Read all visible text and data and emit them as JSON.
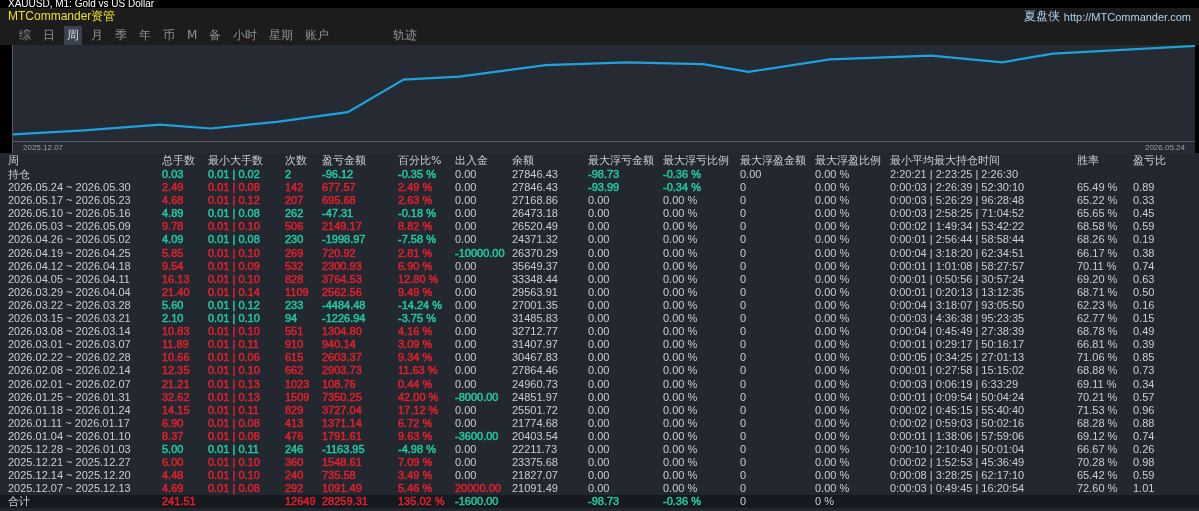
{
  "window": {
    "title": "XAUUSD, M1: Gold vs US Dollar"
  },
  "header": {
    "app_name": "MTCommander资管",
    "brand": "夏盘侠",
    "link": "http://MTCommander.com"
  },
  "tabs": [
    {
      "label": "综",
      "kind": "view",
      "selected": false
    },
    {
      "label": "日",
      "kind": "view",
      "selected": false
    },
    {
      "label": "周",
      "kind": "view",
      "selected": true
    },
    {
      "label": "月",
      "kind": "view",
      "selected": false
    },
    {
      "label": "季",
      "kind": "view",
      "selected": false
    },
    {
      "label": "年",
      "kind": "view",
      "selected": false
    },
    {
      "label": "币",
      "kind": "view",
      "selected": false
    },
    {
      "label": "M",
      "kind": "view",
      "selected": false
    },
    {
      "label": "备",
      "kind": "view",
      "selected": false
    },
    {
      "label": "小时",
      "kind": "view",
      "selected": false
    },
    {
      "label": "星期",
      "kind": "view",
      "selected": false
    },
    {
      "label": "账户",
      "kind": "panel",
      "selected": false
    },
    {
      "label": "轨迹",
      "kind": "panel",
      "selected": false
    }
  ],
  "chart": {
    "start_label": "2025.12.07",
    "end_label": "2026.05.24"
  },
  "table": {
    "columns": [
      "周",
      "总手数",
      "最小大手数",
      "次数",
      "盈亏金额",
      "百分比%",
      "出入金",
      "余额",
      "最大浮亏金额",
      "最大浮亏比例",
      "最大浮盈金额",
      "最大浮盈比例",
      "最小平均最大持仓时间",
      "胜率",
      "盈亏比"
    ],
    "rows": [
      {
        "period": "持仓",
        "lots": {
          "text": "0.03",
          "color": "#22c7a0"
        },
        "lot_range": {
          "text": "0.01 | 0.02",
          "color": "#22c7a0"
        },
        "trades": {
          "text": "2",
          "color": "#22c7a0"
        },
        "profit": {
          "text": "-96.12",
          "color": "#22c7a0"
        },
        "percent": {
          "text": "-0.35 %",
          "color": "#22c7a0"
        },
        "flow": "0.00",
        "balance": "27846.43",
        "max_float_loss": {
          "text": "-98.73",
          "color": "#22c7a0"
        },
        "max_float_loss_pct": {
          "text": "-0.36 %",
          "color": "#22c7a0"
        },
        "max_float_profit": "0.00",
        "max_float_profit_pct": "0.00 %",
        "hold_times": "2:20:21 | 2:23:25 | 2:26:30"
      },
      {
        "period": "2026.05.24 ~ 2026.05.30",
        "lots": {
          "text": "2.49",
          "color": "#e0202c"
        },
        "lot_range": {
          "text": "0.01 | 0.08",
          "color": "#e0202c"
        },
        "trades": {
          "text": "142",
          "color": "#e0202c"
        },
        "profit": {
          "text": "677.57",
          "color": "#e0202c"
        },
        "percent": {
          "text": "2.49 %",
          "color": "#e0202c"
        },
        "flow": "0.00",
        "balance": "27846.43",
        "max_float_loss": {
          "text": "-93.99",
          "color": "#22c7a0"
        },
        "max_float_loss_pct": {
          "text": "-0.34 %",
          "color": "#22c7a0"
        },
        "max_float_profit": "0",
        "max_float_profit_pct": "0.00 %",
        "hold_times": "0:00:03 | 2:26:39 | 52:30:10",
        "win_rate": "65.49 %",
        "pl_ratio": "0.89"
      },
      {
        "period": "2026.05.17 ~ 2026.05.23",
        "lots": {
          "text": "4.68",
          "color": "#e0202c"
        },
        "lot_range": {
          "text": "0.01 | 0.12",
          "color": "#e0202c"
        },
        "trades": {
          "text": "207",
          "color": "#e0202c"
        },
        "profit": {
          "text": "695.68",
          "color": "#e0202c"
        },
        "percent": {
          "text": "2.63 %",
          "color": "#e0202c"
        },
        "flow": "0.00",
        "balance": "27168.86",
        "max_float_loss": "0.00",
        "max_float_loss_pct": "0.00 %",
        "max_float_profit": "0",
        "max_float_profit_pct": "0.00 %",
        "hold_times": "0:00:03 | 5:26:29 | 96:28:48",
        "win_rate": "65.22 %",
        "pl_ratio": "0.33"
      },
      {
        "period": "2026.05.10 ~ 2026.05.16",
        "lots": {
          "text": "4.89",
          "color": "#22c7a0"
        },
        "lot_range": {
          "text": "0.01 | 0.08",
          "color": "#22c7a0"
        },
        "trades": {
          "text": "262",
          "color": "#22c7a0"
        },
        "profit": {
          "text": "-47.31",
          "color": "#22c7a0"
        },
        "percent": {
          "text": "-0.18 %",
          "color": "#22c7a0"
        },
        "flow": "0.00",
        "balance": "26473.18",
        "max_float_loss": "0.00",
        "max_float_loss_pct": "0.00 %",
        "max_float_profit": "0",
        "max_float_profit_pct": "0.00 %",
        "hold_times": "0:00:03 | 2:58:25 | 71:04:52",
        "win_rate": "65.65 %",
        "pl_ratio": "0.45"
      },
      {
        "period": "2026.05.03 ~ 2026.05.09",
        "lots": {
          "text": "9.78",
          "color": "#e0202c"
        },
        "lot_range": {
          "text": "0.01 | 0.10",
          "color": "#e0202c"
        },
        "trades": {
          "text": "506",
          "color": "#e0202c"
        },
        "profit": {
          "text": "2149.17",
          "color": "#e0202c"
        },
        "percent": {
          "text": "8.82 %",
          "color": "#e0202c"
        },
        "flow": "0.00",
        "balance": "26520.49",
        "max_float_loss": "0.00",
        "max_float_loss_pct": "0.00 %",
        "max_float_profit": "0",
        "max_float_profit_pct": "0.00 %",
        "hold_times": "0:00:02 | 1:49:34 | 53:42:22",
        "win_rate": "68.58 %",
        "pl_ratio": "0.59"
      },
      {
        "period": "2026.04.26 ~ 2026.05.02",
        "lots": {
          "text": "4.09",
          "color": "#22c7a0"
        },
        "lot_range": {
          "text": "0.01 | 0.08",
          "color": "#22c7a0"
        },
        "trades": {
          "text": "230",
          "color": "#22c7a0"
        },
        "profit": {
          "text": "-1998.97",
          "color": "#22c7a0"
        },
        "percent": {
          "text": "-7.58 %",
          "color": "#22c7a0"
        },
        "flow": "0.00",
        "balance": "24371.32",
        "max_float_loss": "0.00",
        "max_float_loss_pct": "0.00 %",
        "max_float_profit": "0",
        "max_float_profit_pct": "0.00 %",
        "hold_times": "0:00:01 | 2:56:44 | 58:58:44",
        "win_rate": "68.26 %",
        "pl_ratio": "0.19"
      },
      {
        "period": "2026.04.19 ~ 2026.04.25",
        "lots": {
          "text": "5.85",
          "color": "#e0202c"
        },
        "lot_range": {
          "text": "0.01 | 0.10",
          "color": "#e0202c"
        },
        "trades": {
          "text": "269",
          "color": "#e0202c"
        },
        "profit": {
          "text": "720.92",
          "color": "#e0202c"
        },
        "percent": {
          "text": "2.81 %",
          "color": "#e0202c"
        },
        "flow": {
          "text": "-10000.00",
          "color": "#22c7a0"
        },
        "balance": "26370.29",
        "max_float_loss": "0.00",
        "max_float_loss_pct": "0.00 %",
        "max_float_profit": "0",
        "max_float_profit_pct": "0.00 %",
        "hold_times": "0:00:04 | 3:18:20 | 62:34:51",
        "win_rate": "66.17 %",
        "pl_ratio": "0.38"
      },
      {
        "period": "2026.04.12 ~ 2026.04.18",
        "lots": {
          "text": "9.54",
          "color": "#e0202c"
        },
        "lot_range": {
          "text": "0.01 | 0.09",
          "color": "#e0202c"
        },
        "trades": {
          "text": "532",
          "color": "#e0202c"
        },
        "profit": {
          "text": "2300.93",
          "color": "#e0202c"
        },
        "percent": {
          "text": "6.90 %",
          "color": "#e0202c"
        },
        "flow": "0.00",
        "balance": "35649.37",
        "max_float_loss": "0.00",
        "max_float_loss_pct": "0.00 %",
        "max_float_profit": "0",
        "max_float_profit_pct": "0.00 %",
        "hold_times": "0:00:01 | 1:01:08 | 58:27:57",
        "win_rate": "70.11 %",
        "pl_ratio": "0.74"
      },
      {
        "period": "2026.04.05 ~ 2026.04.11",
        "lots": {
          "text": "16.13",
          "color": "#e0202c"
        },
        "lot_range": {
          "text": "0.01 | 0.10",
          "color": "#e0202c"
        },
        "trades": {
          "text": "828",
          "color": "#e0202c"
        },
        "profit": {
          "text": "3764.53",
          "color": "#e0202c"
        },
        "percent": {
          "text": "12.80 %",
          "color": "#e0202c"
        },
        "flow": "0.00",
        "balance": "33348.44",
        "max_float_loss": "0.00",
        "max_float_loss_pct": "0.00 %",
        "max_float_profit": "0",
        "max_float_profit_pct": "0.00 %",
        "hold_times": "0:00:01 | 0:50:56 | 30:57:24",
        "win_rate": "69.20 %",
        "pl_ratio": "0.63"
      },
      {
        "period": "2026.03.29 ~ 2026.04.04",
        "lots": {
          "text": "21.40",
          "color": "#e0202c"
        },
        "lot_range": {
          "text": "0.01 | 0.14",
          "color": "#e0202c"
        },
        "trades": {
          "text": "1109",
          "color": "#e0202c"
        },
        "profit": {
          "text": "2562.56",
          "color": "#e0202c"
        },
        "percent": {
          "text": "9.49 %",
          "color": "#e0202c"
        },
        "flow": "0.00",
        "balance": "29563.91",
        "max_float_loss": "0.00",
        "max_float_loss_pct": "0.00 %",
        "max_float_profit": "0",
        "max_float_profit_pct": "0.00 %",
        "hold_times": "0:00:01 | 0:20:13 | 13:12:35",
        "win_rate": "68.71 %",
        "pl_ratio": "0.50"
      },
      {
        "period": "2026.03.22 ~ 2026.03.28",
        "lots": {
          "text": "5.60",
          "color": "#22c7a0"
        },
        "lot_range": {
          "text": "0.01 | 0.12",
          "color": "#22c7a0"
        },
        "trades": {
          "text": "233",
          "color": "#22c7a0"
        },
        "profit": {
          "text": "-4484.48",
          "color": "#22c7a0"
        },
        "percent": {
          "text": "-14.24 %",
          "color": "#22c7a0"
        },
        "flow": "0.00",
        "balance": "27001.35",
        "max_float_loss": "0.00",
        "max_float_loss_pct": "0.00 %",
        "max_float_profit": "0",
        "max_float_profit_pct": "0.00 %",
        "hold_times": "0:00:04 | 3:18:07 | 93:05:50",
        "win_rate": "62.23 %",
        "pl_ratio": "0.16"
      },
      {
        "period": "2026.03.15 ~ 2026.03.21",
        "lots": {
          "text": "2.10",
          "color": "#22c7a0"
        },
        "lot_range": {
          "text": "0.01 | 0.10",
          "color": "#22c7a0"
        },
        "trades": {
          "text": "94",
          "color": "#22c7a0"
        },
        "profit": {
          "text": "-1226.94",
          "color": "#22c7a0"
        },
        "percent": {
          "text": "-3.75 %",
          "color": "#22c7a0"
        },
        "flow": "0.00",
        "balance": "31485.83",
        "max_float_loss": "0.00",
        "max_float_loss_pct": "0.00 %",
        "max_float_profit": "0",
        "max_float_profit_pct": "0.00 %",
        "hold_times": "0:00:03 | 4:36:38 | 95:23:35",
        "win_rate": "62.77 %",
        "pl_ratio": "0.15"
      },
      {
        "period": "2026.03.08 ~ 2026.03.14",
        "lots": {
          "text": "10.83",
          "color": "#e0202c"
        },
        "lot_range": {
          "text": "0.01 | 0.10",
          "color": "#e0202c"
        },
        "trades": {
          "text": "551",
          "color": "#e0202c"
        },
        "profit": {
          "text": "1304.80",
          "color": "#e0202c"
        },
        "percent": {
          "text": "4.16 %",
          "color": "#e0202c"
        },
        "flow": "0.00",
        "balance": "32712.77",
        "max_float_loss": "0.00",
        "max_float_loss_pct": "0.00 %",
        "max_float_profit": "0",
        "max_float_profit_pct": "0.00 %",
        "hold_times": "0:00:04 | 0:45:49 | 27:38:39",
        "win_rate": "68.78 %",
        "pl_ratio": "0.49"
      },
      {
        "period": "2026.03.01 ~ 2026.03.07",
        "lots": {
          "text": "11.89",
          "color": "#e0202c"
        },
        "lot_range": {
          "text": "0.01 | 0.11",
          "color": "#e0202c"
        },
        "trades": {
          "text": "910",
          "color": "#e0202c"
        },
        "profit": {
          "text": "940.14",
          "color": "#e0202c"
        },
        "percent": {
          "text": "3.09 %",
          "color": "#e0202c"
        },
        "flow": "0.00",
        "balance": "31407.97",
        "max_float_loss": "0.00",
        "max_float_loss_pct": "0.00 %",
        "max_float_profit": "0",
        "max_float_profit_pct": "0.00 %",
        "hold_times": "0:00:01 | 0:29:17 | 50:16:17",
        "win_rate": "66.81 %",
        "pl_ratio": "0.39"
      },
      {
        "period": "2026.02.22 ~ 2026.02.28",
        "lots": {
          "text": "10.66",
          "color": "#e0202c"
        },
        "lot_range": {
          "text": "0.01 | 0.06",
          "color": "#e0202c"
        },
        "trades": {
          "text": "615",
          "color": "#e0202c"
        },
        "profit": {
          "text": "2603.37",
          "color": "#e0202c"
        },
        "percent": {
          "text": "9.34 %",
          "color": "#e0202c"
        },
        "flow": "0.00",
        "balance": "30467.83",
        "max_float_loss": "0.00",
        "max_float_loss_pct": "0.00 %",
        "max_float_profit": "0",
        "max_float_profit_pct": "0.00 %",
        "hold_times": "0:00:05 | 0:34:25 | 27:01:13",
        "win_rate": "71.06 %",
        "pl_ratio": "0.85"
      },
      {
        "period": "2026.02.08 ~ 2026.02.14",
        "lots": {
          "text": "12.35",
          "color": "#e0202c"
        },
        "lot_range": {
          "text": "0.01 | 0.10",
          "color": "#e0202c"
        },
        "trades": {
          "text": "662",
          "color": "#e0202c"
        },
        "profit": {
          "text": "2903.73",
          "color": "#e0202c"
        },
        "percent": {
          "text": "11.63 %",
          "color": "#e0202c"
        },
        "flow": "0.00",
        "balance": "27864.46",
        "max_float_loss": "0.00",
        "max_float_loss_pct": "0.00 %",
        "max_float_profit": "0",
        "max_float_profit_pct": "0.00 %",
        "hold_times": "0:00:01 | 0:27:58 | 15:15:02",
        "win_rate": "68.88 %",
        "pl_ratio": "0.73"
      },
      {
        "period": "2026.02.01 ~ 2026.02.07",
        "lots": {
          "text": "21.21",
          "color": "#e0202c"
        },
        "lot_range": {
          "text": "0.01 | 0.13",
          "color": "#e0202c"
        },
        "trades": {
          "text": "1023",
          "color": "#e0202c"
        },
        "profit": {
          "text": "108.76",
          "color": "#e0202c"
        },
        "percent": {
          "text": "0.44 %",
          "color": "#e0202c"
        },
        "flow": "0.00",
        "balance": "24960.73",
        "max_float_loss": "0.00",
        "max_float_loss_pct": "0.00 %",
        "max_float_profit": "0",
        "max_float_profit_pct": "0.00 %",
        "hold_times": "0:00:03 | 0:06:19 | 6:33:29",
        "win_rate": "69.11 %",
        "pl_ratio": "0.34"
      },
      {
        "period": "2026.01.25 ~ 2026.01.31",
        "lots": {
          "text": "32.62",
          "color": "#e0202c"
        },
        "lot_range": {
          "text": "0.01 | 0.13",
          "color": "#e0202c"
        },
        "trades": {
          "text": "1509",
          "color": "#e0202c"
        },
        "profit": {
          "text": "7350.25",
          "color": "#e0202c"
        },
        "percent": {
          "text": "42.00 %",
          "color": "#e0202c"
        },
        "flow": {
          "text": "-8000.00",
          "color": "#22c7a0"
        },
        "balance": "24851.97",
        "max_float_loss": "0.00",
        "max_float_loss_pct": "0.00 %",
        "max_float_profit": "0",
        "max_float_profit_pct": "0.00 %",
        "hold_times": "0:00:01 | 0:09:54 | 50:04:24",
        "win_rate": "70.21 %",
        "pl_ratio": "0.57"
      },
      {
        "period": "2026.01.18 ~ 2026.01.24",
        "lots": {
          "text": "14.15",
          "color": "#e0202c"
        },
        "lot_range": {
          "text": "0.01 | 0.11",
          "color": "#e0202c"
        },
        "trades": {
          "text": "829",
          "color": "#e0202c"
        },
        "profit": {
          "text": "3727.04",
          "color": "#e0202c"
        },
        "percent": {
          "text": "17.12 %",
          "color": "#e0202c"
        },
        "flow": "0.00",
        "balance": "25501.72",
        "max_float_loss": "0.00",
        "max_float_loss_pct": "0.00 %",
        "max_float_profit": "0",
        "max_float_profit_pct": "0.00 %",
        "hold_times": "0:00:02 | 0:45:15 | 55:40:40",
        "win_rate": "71.53 %",
        "pl_ratio": "0.96"
      },
      {
        "period": "2026.01.11 ~ 2026.01.17",
        "lots": {
          "text": "6.90",
          "color": "#e0202c"
        },
        "lot_range": {
          "text": "0.01 | 0.08",
          "color": "#e0202c"
        },
        "trades": {
          "text": "413",
          "color": "#e0202c"
        },
        "profit": {
          "text": "1371.14",
          "color": "#e0202c"
        },
        "percent": {
          "text": "6.72 %",
          "color": "#e0202c"
        },
        "flow": "0.00",
        "balance": "21774.68",
        "max_float_loss": "0.00",
        "max_float_loss_pct": "0.00 %",
        "max_float_profit": "0",
        "max_float_profit_pct": "0.00 %",
        "hold_times": "0:00:02 | 0:59:03 | 50:02:16",
        "win_rate": "68.28 %",
        "pl_ratio": "0.88"
      },
      {
        "period": "2026.01.04 ~ 2026.01.10",
        "lots": {
          "text": "8.37",
          "color": "#e0202c"
        },
        "lot_range": {
          "text": "0.01 | 0.08",
          "color": "#e0202c"
        },
        "trades": {
          "text": "476",
          "color": "#e0202c"
        },
        "profit": {
          "text": "1791.61",
          "color": "#e0202c"
        },
        "percent": {
          "text": "9.63 %",
          "color": "#e0202c"
        },
        "flow": {
          "text": "-3600.00",
          "color": "#22c7a0"
        },
        "balance": "20403.54",
        "max_float_loss": "0.00",
        "max_float_loss_pct": "0.00 %",
        "max_float_profit": "0",
        "max_float_profit_pct": "0.00 %",
        "hold_times": "0:00:01 | 1:38:06 | 57:59:06",
        "win_rate": "69.12 %",
        "pl_ratio": "0.74"
      },
      {
        "period": "2025.12.28 ~ 2026.01.03",
        "lots": {
          "text": "5.00",
          "color": "#22c7a0"
        },
        "lot_range": {
          "text": "0.01 | 0.11",
          "color": "#22c7a0"
        },
        "trades": {
          "text": "246",
          "color": "#22c7a0"
        },
        "profit": {
          "text": "-1163.95",
          "color": "#22c7a0"
        },
        "percent": {
          "text": "-4.98 %",
          "color": "#22c7a0"
        },
        "flow": "0.00",
        "balance": "22211.73",
        "max_float_loss": "0.00",
        "max_float_loss_pct": "0.00 %",
        "max_float_profit": "0",
        "max_float_profit_pct": "0.00 %",
        "hold_times": "0:00:10 | 2:10:40 | 50:01:04",
        "win_rate": "66.67 %",
        "pl_ratio": "0.26"
      },
      {
        "period": "2025.12.21 ~ 2025.12.27",
        "lots": {
          "text": "6.00",
          "color": "#e0202c"
        },
        "lot_range": {
          "text": "0.01 | 0.10",
          "color": "#e0202c"
        },
        "trades": {
          "text": "360",
          "color": "#e0202c"
        },
        "profit": {
          "text": "1548.61",
          "color": "#e0202c"
        },
        "percent": {
          "text": "7.09 %",
          "color": "#e0202c"
        },
        "flow": "0.00",
        "balance": "23375.68",
        "max_float_loss": "0.00",
        "max_float_loss_pct": "0.00 %",
        "max_float_profit": "0",
        "max_float_profit_pct": "0.00 %",
        "hold_times": "0:00:02 | 1:52:53 | 45:36:49",
        "win_rate": "70.28 %",
        "pl_ratio": "0.98"
      },
      {
        "period": "2025.12.14 ~ 2025.12.20",
        "lots": {
          "text": "4.48",
          "color": "#e0202c"
        },
        "lot_range": {
          "text": "0.01 | 0.10",
          "color": "#e0202c"
        },
        "trades": {
          "text": "240",
          "color": "#e0202c"
        },
        "profit": {
          "text": "735.58",
          "color": "#e0202c"
        },
        "percent": {
          "text": "3.49 %",
          "color": "#e0202c"
        },
        "flow": "0.00",
        "balance": "21827.07",
        "max_float_loss": "0.00",
        "max_float_loss_pct": "0.00 %",
        "max_float_profit": "0",
        "max_float_profit_pct": "0.00 %",
        "hold_times": "0:00:08 | 3:28:25 | 62:17:10",
        "win_rate": "65.42 %",
        "pl_ratio": "0.59"
      },
      {
        "period": "2025.12.07 ~ 2025.12.13",
        "lots": {
          "text": "4.69",
          "color": "#e0202c"
        },
        "lot_range": {
          "text": "0.01 | 0.08",
          "color": "#e0202c"
        },
        "trades": {
          "text": "292",
          "color": "#e0202c"
        },
        "profit": {
          "text": "1091.49",
          "color": "#e0202c"
        },
        "percent": {
          "text": "5.46 %",
          "color": "#e0202c"
        },
        "flow": {
          "text": "20000.00",
          "color": "#e0202c"
        },
        "balance": "21091.49",
        "max_float_loss": "0.00",
        "max_float_loss_pct": "0.00 %",
        "max_float_profit": "0",
        "max_float_profit_pct": "0.00 %",
        "hold_times": "0:00:03 | 0:49:45 | 16:20:54",
        "win_rate": "72.60 %",
        "pl_ratio": "1.01"
      }
    ],
    "total": {
      "period": "合计",
      "lots": {
        "text": "241.51",
        "color": "#e0202c"
      },
      "trades": {
        "text": "12649",
        "color": "#e0202c"
      },
      "profit": {
        "text": "28259.31",
        "color": "#e0202c"
      },
      "percent": {
        "text": "135.02 %",
        "color": "#e0202c"
      },
      "flow": {
        "text": "-1600.00",
        "color": "#22c7a0"
      },
      "max_float_loss": {
        "text": "-98.73",
        "color": "#22c7a0"
      },
      "max_float_loss_pct": {
        "text": "-0.36 %",
        "color": "#22c7a0"
      },
      "max_float_profit": "0",
      "max_float_profit_pct": "0 %"
    }
  }
}
